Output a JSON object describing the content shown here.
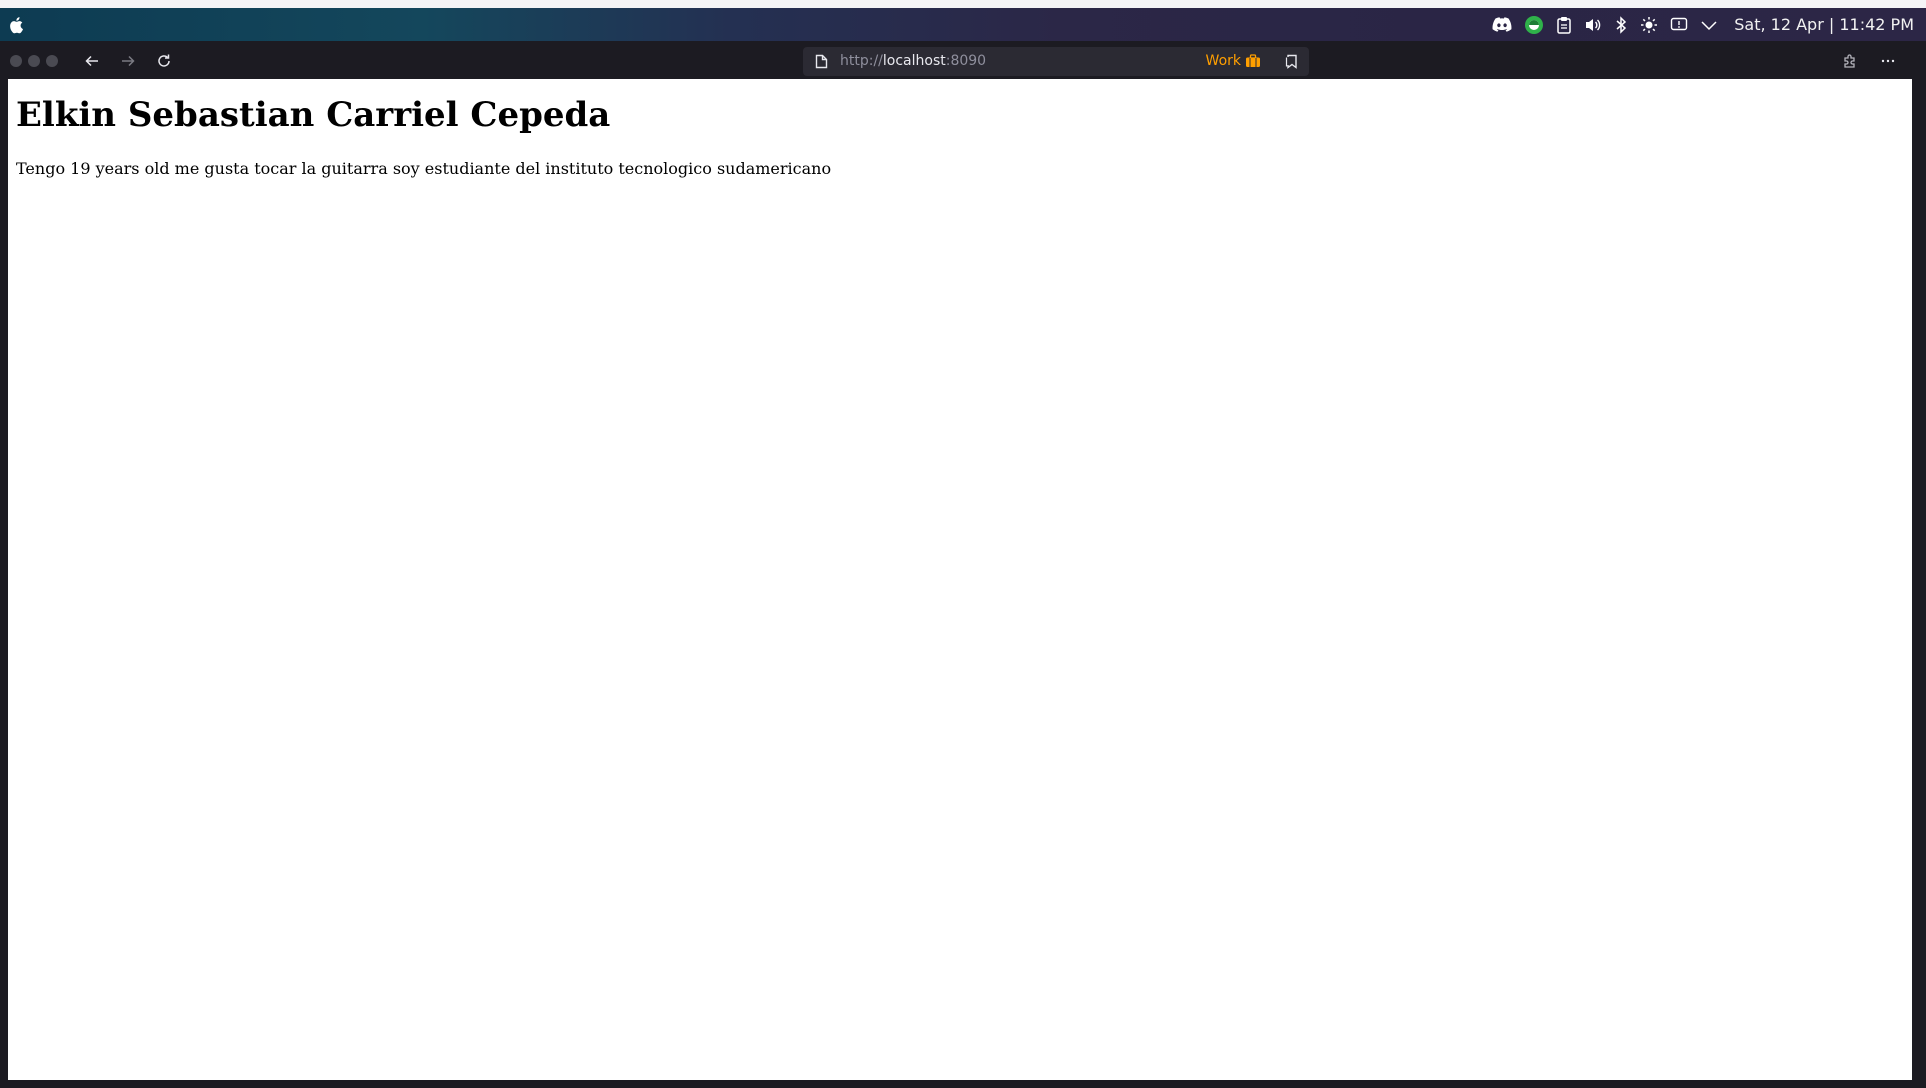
{
  "system_bar": {
    "clock": "Sat, 12 Apr | 11:42 PM",
    "icons": [
      "apple-icon",
      "discord-icon",
      "green-app-icon",
      "clipboard-icon",
      "volume-icon",
      "bluetooth-icon",
      "brightness-icon",
      "notification-icon",
      "chevron-down-icon"
    ]
  },
  "browser": {
    "url_scheme": "http://",
    "url_host": "localhost",
    "url_port": ":8090",
    "container_label": "Work",
    "container_color": "#ff9f00"
  },
  "page": {
    "heading": "Elkin Sebastian Carriel Cepeda",
    "paragraph": "Tengo 19 years old me gusta tocar la guitarra soy estudiante del instituto tecnologico sudamericano"
  }
}
